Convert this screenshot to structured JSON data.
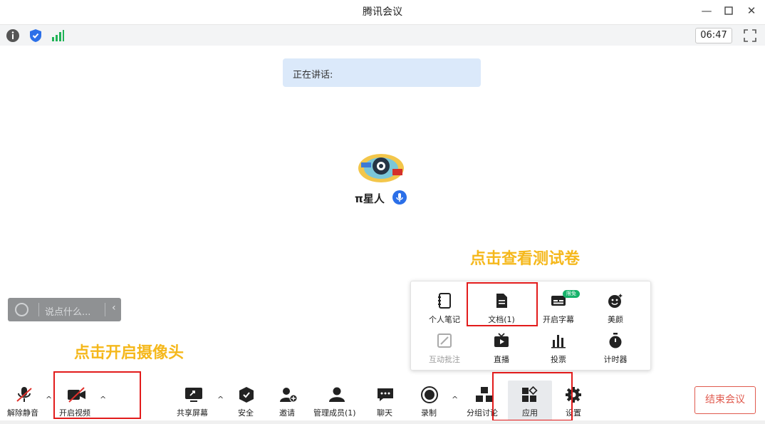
{
  "window": {
    "title": "腾讯会议"
  },
  "info_bar": {
    "timer": "06:47"
  },
  "speaking": {
    "label": "正在讲话:"
  },
  "participant": {
    "name": "π星人"
  },
  "annotations": {
    "apps_hint": "点击查看测试卷",
    "camera_hint": "点击开启摄像头"
  },
  "chat": {
    "placeholder": "说点什么..."
  },
  "app_panel": {
    "items": [
      {
        "label": "个人笔记",
        "icon": "notebook-icon"
      },
      {
        "label": "文档(1)",
        "icon": "document-icon"
      },
      {
        "label": "开启字幕",
        "icon": "subtitles-icon",
        "badge": "限免"
      },
      {
        "label": "美颜",
        "icon": "beauty-icon"
      },
      {
        "label": "互动批注",
        "icon": "annotate-icon",
        "disabled": true
      },
      {
        "label": "直播",
        "icon": "live-icon"
      },
      {
        "label": "投票",
        "icon": "vote-icon"
      },
      {
        "label": "计时器",
        "icon": "timer-icon"
      }
    ]
  },
  "toolbar": {
    "unmute": "解除静音",
    "start_video": "开启视频",
    "share_screen": "共享屏幕",
    "security": "安全",
    "invite": "邀请",
    "manage_members": "管理成员(1)",
    "chat": "聊天",
    "record": "录制",
    "breakout": "分组讨论",
    "apps": "应用",
    "settings": "设置",
    "end_meeting": "结束会议"
  },
  "colors": {
    "accent": "#2b6fe8",
    "annotation": "#f5b81c",
    "highlight_box": "#e21b1b",
    "end_button": "#e05a4e"
  }
}
